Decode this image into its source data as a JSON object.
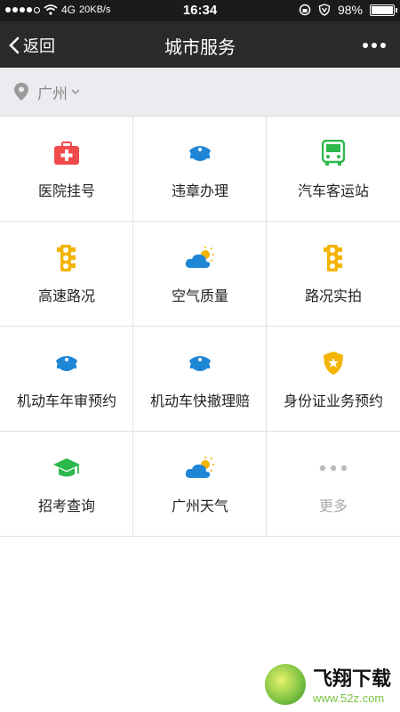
{
  "status_bar": {
    "carrier": "4G",
    "speed": "20KB/s",
    "time": "16:34",
    "battery": "98%"
  },
  "navbar": {
    "back_label": "返回",
    "title": "城市服务"
  },
  "location": {
    "city": "广州"
  },
  "services": [
    {
      "label": "医院挂号",
      "icon": "medical-kit-icon",
      "color": "#f04a4a"
    },
    {
      "label": "违章办理",
      "icon": "police-cap-icon",
      "color": "#1f86d6"
    },
    {
      "label": "汽车客运站",
      "icon": "bus-icon",
      "color": "#2cb84b"
    },
    {
      "label": "高速路况",
      "icon": "traffic-light-icon",
      "color": "#f4b400"
    },
    {
      "label": "空气质量",
      "icon": "weather-cloud-sun-icon",
      "color": "#1f86d6"
    },
    {
      "label": "路况实拍",
      "icon": "traffic-light-icon",
      "color": "#f4b400"
    },
    {
      "label": "机动车年审预约",
      "icon": "police-cap-icon",
      "color": "#1f86d6"
    },
    {
      "label": "机动车快撤理赔",
      "icon": "police-cap-icon",
      "color": "#1f86d6"
    },
    {
      "label": "身份证业务预约",
      "icon": "badge-shield-icon",
      "color": "#f4b400"
    },
    {
      "label": "招考查询",
      "icon": "graduation-cap-icon",
      "color": "#2cb84b"
    },
    {
      "label": "广州天气",
      "icon": "weather-cloud-sun-icon",
      "color": "#1f86d6"
    },
    {
      "label": "更多",
      "icon": "more-dots-icon",
      "color": "#bbbbbb"
    }
  ],
  "watermark": {
    "brand": "飞翔下载",
    "url": "www.52z.com"
  }
}
